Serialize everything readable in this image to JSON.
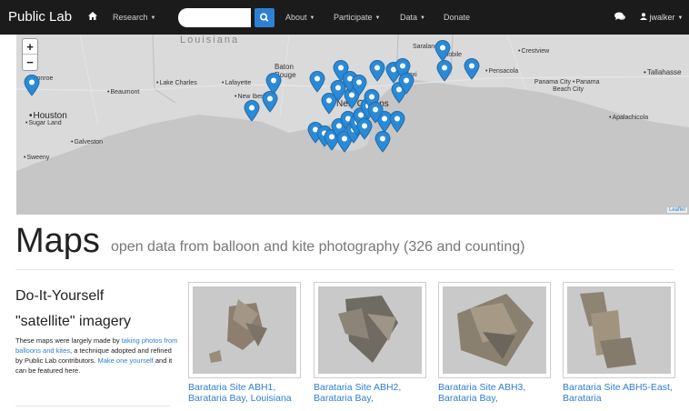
{
  "navbar": {
    "brand": "Public Lab",
    "research": "Research",
    "search_placeholder": "",
    "about": "About",
    "participate": "Participate",
    "data": "Data",
    "donate": "Donate",
    "username": "jwalker"
  },
  "map": {
    "zoom_in": "+",
    "zoom_out": "−",
    "attribution": "Leaflet",
    "places": {
      "louisiana": "Louisiana",
      "conroe": "Conroe",
      "beaumont": "Beaumont",
      "lake_charles": "Lake Charles",
      "lafayette": "Lafayette",
      "baton_rouge": "Baton Rouge",
      "new_iberia": "New Iberia",
      "new_orleans": "New Orleans",
      "houston": "Houston",
      "sugar_land": "Sugar Land",
      "galveston": "Galveston",
      "sweeny": "Sweeny",
      "saraland": "Saraland",
      "mobile": "Mobile",
      "biloxi": "Biloxi",
      "crestview": "Crestview",
      "pensacola": "Pensacola",
      "panama_city_beach": "Panama City Beach",
      "panama_city": "Panama City",
      "tallahassee": "Tallahasse",
      "apalachicola": "Apalachicola"
    }
  },
  "header": {
    "title": "Maps",
    "subtitle": "open data from balloon and kite photography (326 and counting)"
  },
  "sidebar": {
    "title_line1": "Do-It-Yourself",
    "title_line2": "\"satellite\" imagery",
    "text_a": "These maps were largely made by ",
    "link_a": "taking photos from balloons and kites",
    "text_b": ", a technique adopted and refined by Public Lab contributors. ",
    "link_b": "Make one yourself",
    "text_c": " and it can be featured here."
  },
  "maps": [
    {
      "title": "Barataria Site ABH1, Barataria Bay, Louisiana"
    },
    {
      "title": "Barataria Site ABH2, Barataria Bay,"
    },
    {
      "title": "Barataria Site ABH3, Barataria Bay,"
    },
    {
      "title": "Barataria Site ABH5-East, Barataria"
    }
  ],
  "colors": {
    "navbar": "#1b1b1b",
    "accent": "#2f7fd4",
    "map_land": "#d8d8d8",
    "map_water": "#c4c4c4"
  }
}
